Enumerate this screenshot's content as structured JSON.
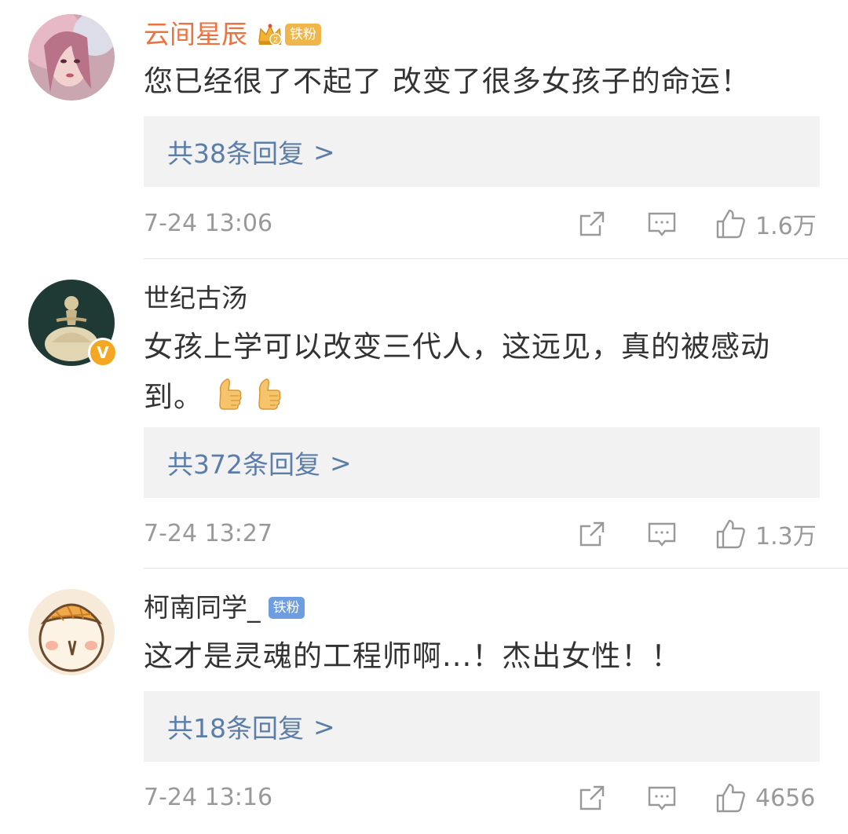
{
  "comments": [
    {
      "username": "云间星辰",
      "fan_badge": "铁粉",
      "text": "您已经很了不起了 改变了很多女孩子的命运！",
      "reply_label": "共38条回复",
      "reply_arrow": ">",
      "time": "7-24 13:06",
      "likes": "1.6万"
    },
    {
      "username": "世纪古汤",
      "verified_badge": "V",
      "text": "女孩上学可以改变三代人，这远见，真的被感动到。",
      "reply_label": "共372条回复",
      "reply_arrow": ">",
      "time": "7-24 13:27",
      "likes": "1.3万"
    },
    {
      "username": "柯南同学_",
      "fan_badge": "铁粉",
      "text": "这才是灵魂的工程师啊...！杰出女性！！",
      "reply_label": "共18条回复",
      "reply_arrow": ">",
      "time": "7-24 13:16",
      "likes": "4656"
    }
  ],
  "icons": {
    "share": "share-icon",
    "comment": "comment-icon",
    "like": "thumbs-up-icon",
    "thumbs_emoji": "thumbs-up-emoji"
  },
  "colors": {
    "vip_name": "#eb7340",
    "reply_link": "#5b7ea8",
    "meta_gray": "#999999",
    "reply_bg": "#f2f2f2"
  }
}
